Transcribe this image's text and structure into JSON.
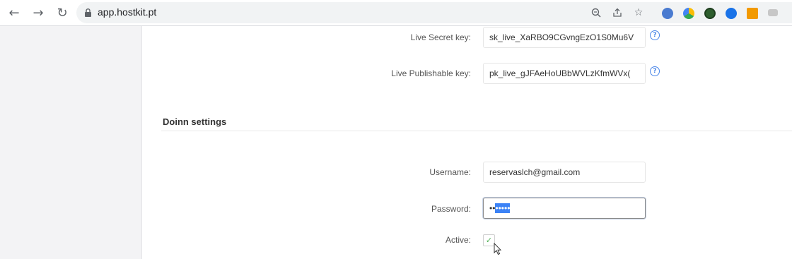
{
  "browser": {
    "url": "app.hostkit.pt",
    "nav": {
      "back_icon": "arrow-left-icon",
      "forward_icon": "arrow-right-icon",
      "reload_icon": "reload-icon"
    }
  },
  "stripe": {
    "secret_label": "Live Secret key:",
    "secret_value": "sk_live_XaRBO9CGvngEzO1S0Mu6V",
    "publishable_label": "Live Publishable key:",
    "publishable_value": "pk_live_gJFAeHoUBbWVLzKfmWVx("
  },
  "doinn": {
    "section_title": "Doinn settings",
    "username_label": "Username:",
    "username_value": "reservaslch@gmail.com",
    "password_label": "Password:",
    "password_masked_prefix": "••",
    "password_masked_selected": "•••••",
    "active_label": "Active:",
    "active_checked": true
  },
  "colors": {
    "accent": "#4a86e8",
    "check": "#4caf50"
  }
}
